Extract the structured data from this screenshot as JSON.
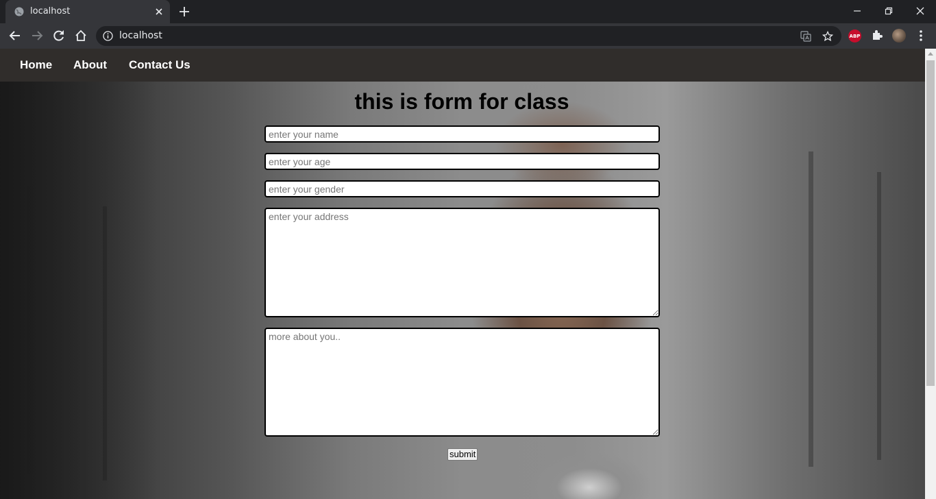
{
  "browser": {
    "tab_title": "localhost",
    "url": "localhost",
    "extension_badge": "ABP"
  },
  "nav": {
    "items": [
      {
        "label": "Home"
      },
      {
        "label": "About"
      },
      {
        "label": "Contact Us"
      }
    ]
  },
  "form": {
    "heading": "this is form for class",
    "name_placeholder": "enter your name",
    "age_placeholder": "enter your age",
    "gender_placeholder": "enter your gender",
    "address_placeholder": "enter your address",
    "more_placeholder": "more about you..",
    "submit_label": "submit"
  },
  "colors": {
    "nav_bg": "#302d2b",
    "chrome_bg": "#202124",
    "toolbar_bg": "#35363a"
  }
}
